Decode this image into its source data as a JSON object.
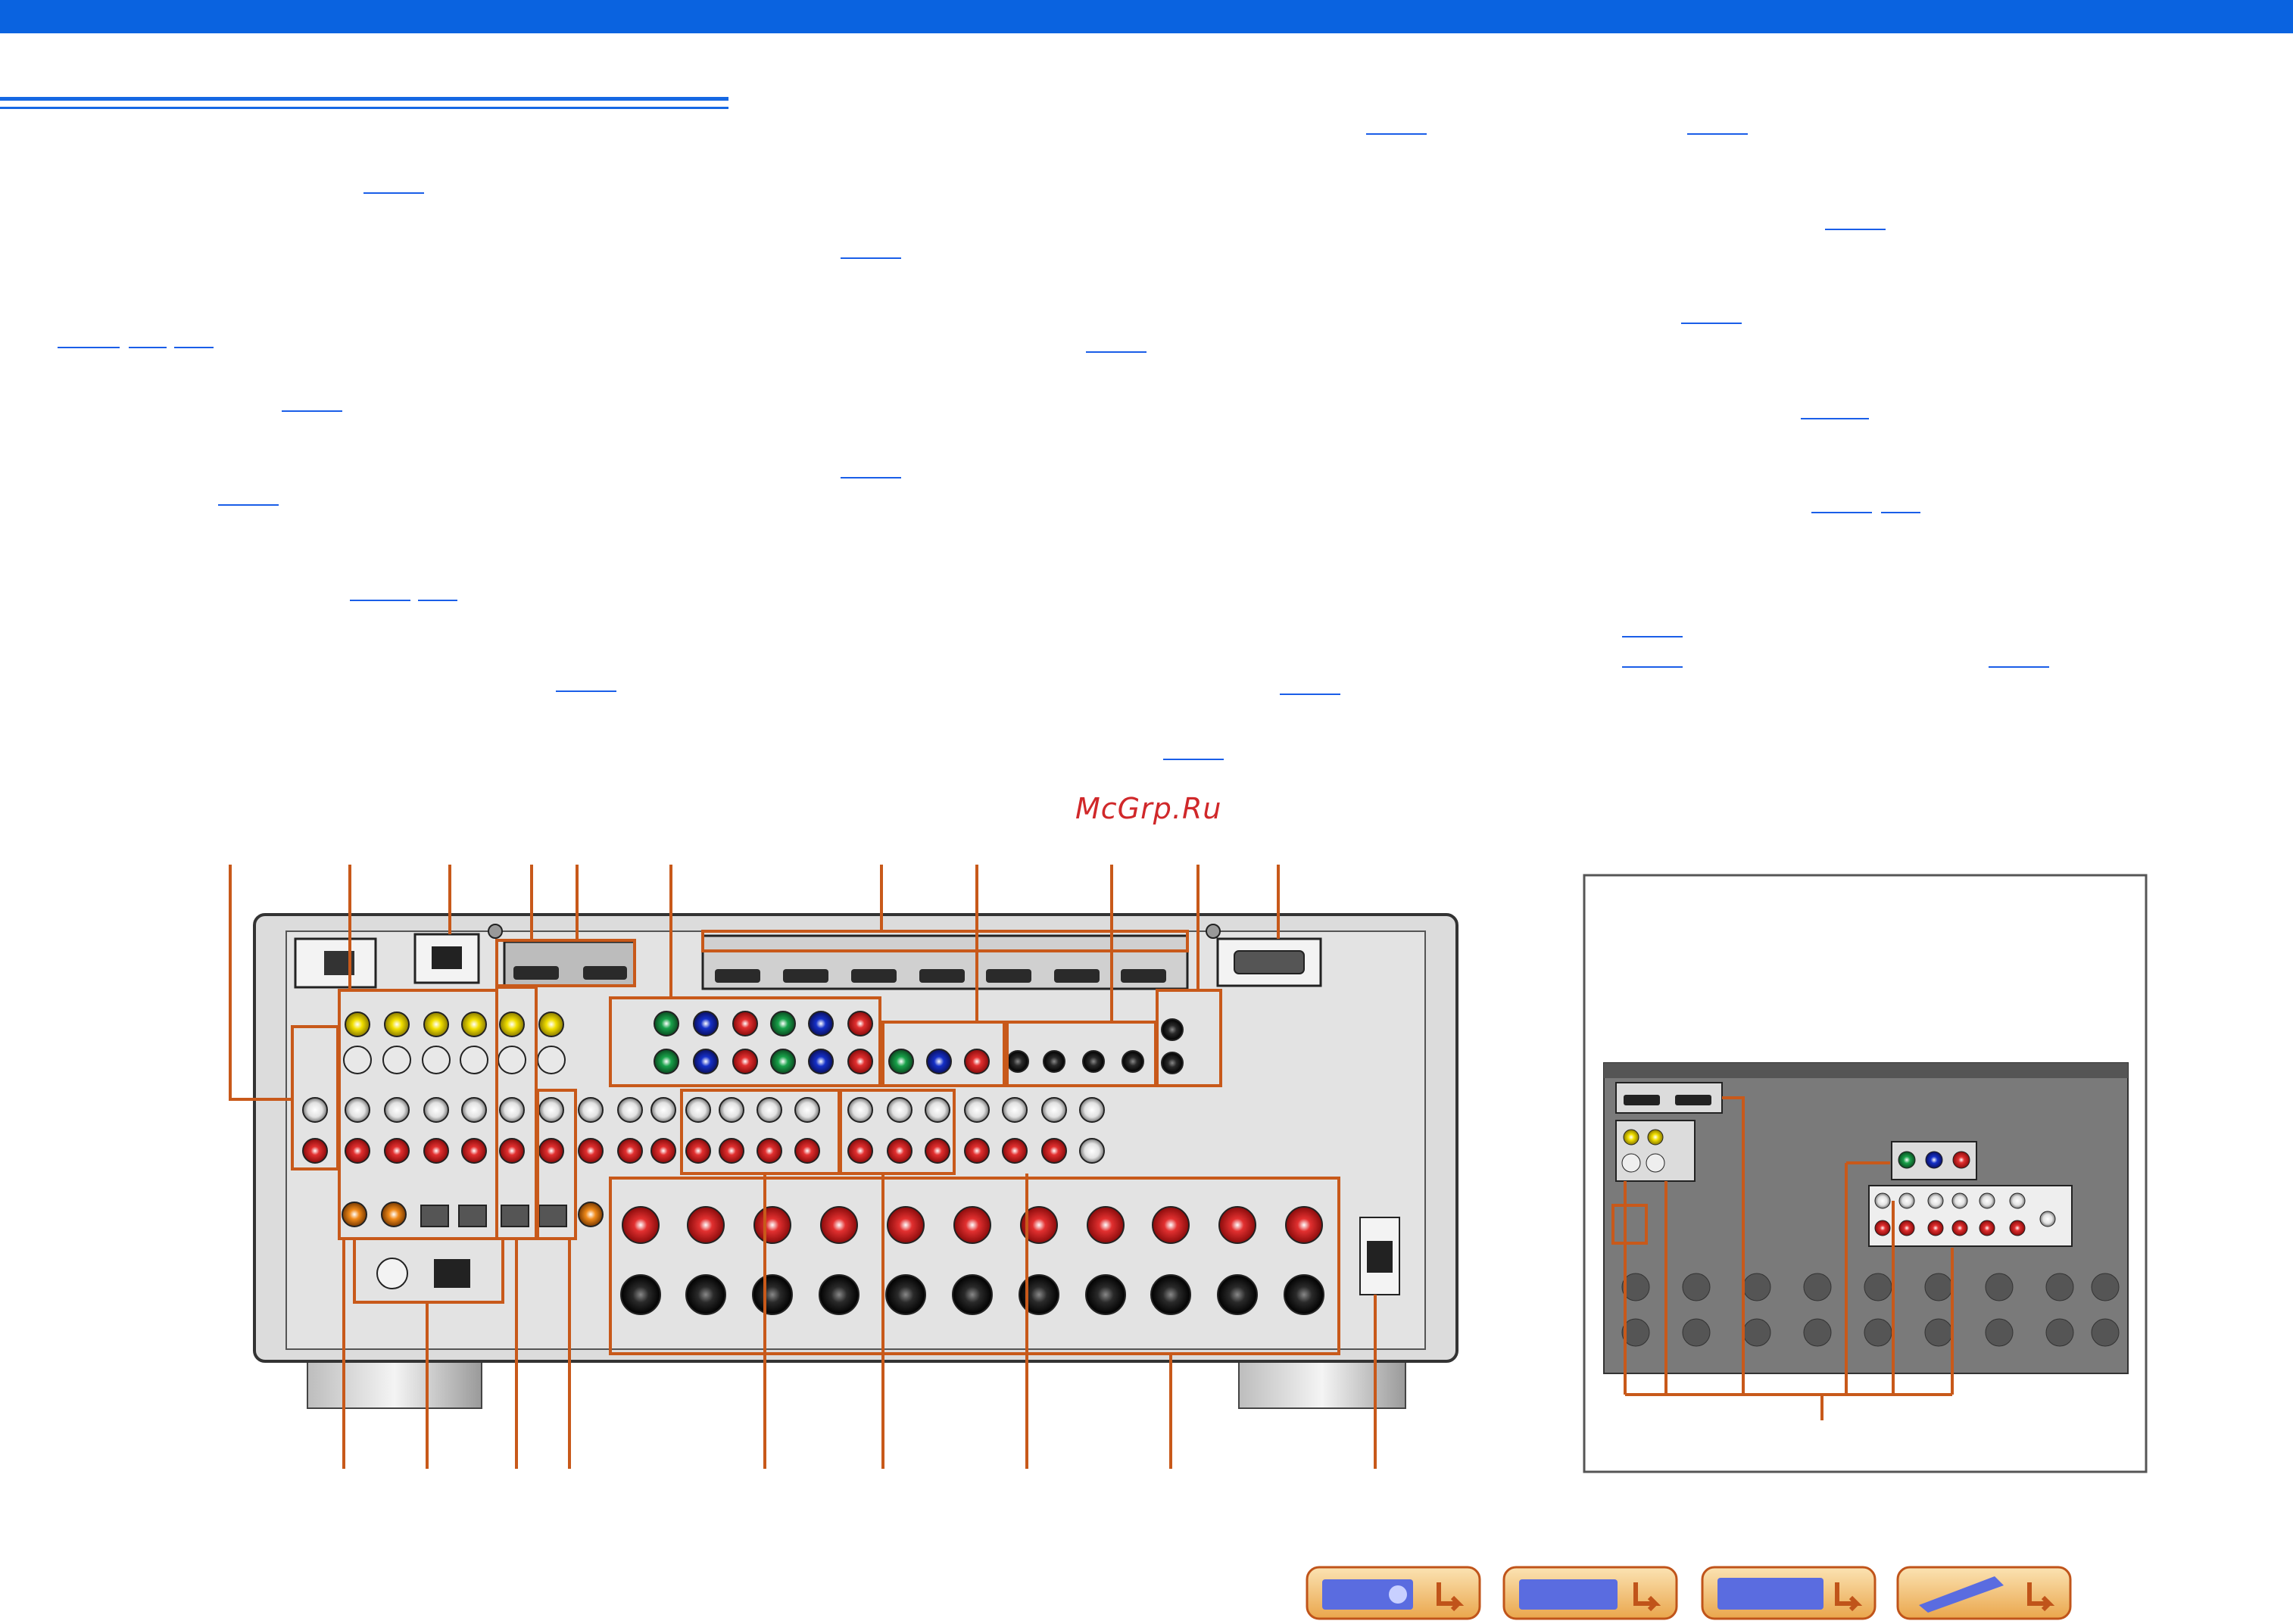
{
  "watermark": "McGrp.Ru",
  "nav_buttons": [
    {
      "name": "front-panel-nav-button",
      "icon": "receiver-front-icon"
    },
    {
      "name": "rear-panel-nav-button",
      "icon": "receiver-rear-icon"
    },
    {
      "name": "display-nav-button",
      "icon": "display-panel-icon"
    },
    {
      "name": "remote-nav-button",
      "icon": "remote-control-icon"
    }
  ],
  "colors": {
    "header": "#0a63e0",
    "callout": "#c8591a",
    "link": "#1a5ee8",
    "nav_button": "#f2c27a",
    "nav_arrow": "#c0541a"
  }
}
